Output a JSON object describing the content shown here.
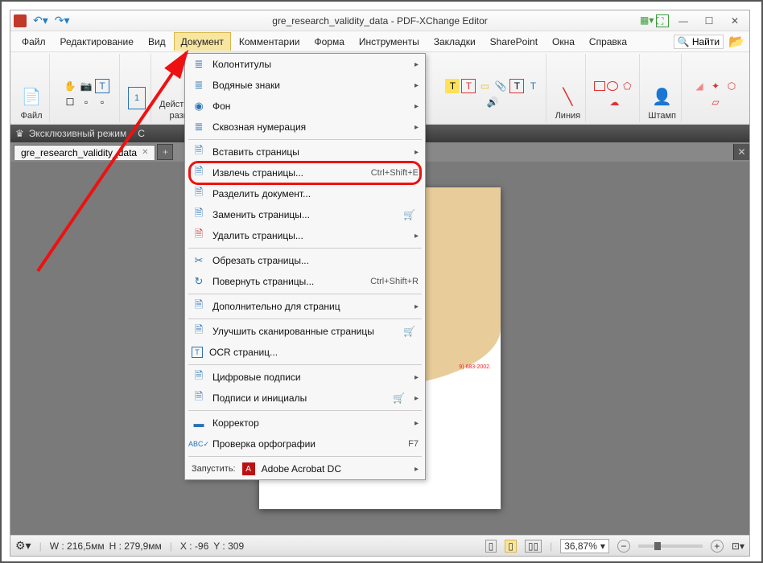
{
  "title": "gre_research_validity_data - PDF-XChange Editor",
  "menus": {
    "file": "Файл",
    "edit": "Редактирование",
    "view": "Вид",
    "document": "Документ",
    "comments": "Комментарии",
    "form": "Форма",
    "tools": "Инструменты",
    "bookmarks": "Закладки",
    "sharepoint": "SharePoint",
    "window": "Окна",
    "help": "Справка",
    "find": "Найти"
  },
  "ribbon": {
    "file": "Файл",
    "actions": "Действия",
    "various": "разн",
    "c": "С",
    "line": "Линия",
    "stamp": "Штамп"
  },
  "mode": {
    "label": "Эксклюзивный режим"
  },
  "tab": {
    "name": "gre_research_validity_data"
  },
  "dropdown": {
    "headers_footers": "Колонтитулы",
    "watermarks": "Водяные знаки",
    "background": "Фон",
    "bates": "Сквозная нумерация",
    "insert_pages": "Вставить страницы",
    "extract_pages": "Извлечь страницы...",
    "extract_pages_sc": "Ctrl+Shift+E",
    "split": "Разделить документ...",
    "replace": "Заменить страницы...",
    "delete": "Удалить страницы...",
    "crop": "Обрезать страницы...",
    "rotate": "Повернуть страницы...",
    "rotate_sc": "Ctrl+Shift+R",
    "extras": "Дополнительно для страниц",
    "enhance": "Улучшить сканированные страницы",
    "ocr": "OCR страниц...",
    "signatures": "Цифровые подписи",
    "initials": "Подписи и инициалы",
    "redact": "Корректор",
    "spell": "Проверка орфографии",
    "spell_sc": "F7",
    "launch": "Запустить:",
    "acrobat": "Adobe Acrobat DC"
  },
  "status": {
    "w_label": "W :",
    "w_val": "216,5мм",
    "h_label": "H :",
    "h_val": "279,9мм",
    "x_label": "X :",
    "x_val": "-96",
    "y_label": "Y :",
    "y_val": "309",
    "zoom": "36,87%"
  },
  "page": {
    "contact_line": "9) 683-2002."
  }
}
